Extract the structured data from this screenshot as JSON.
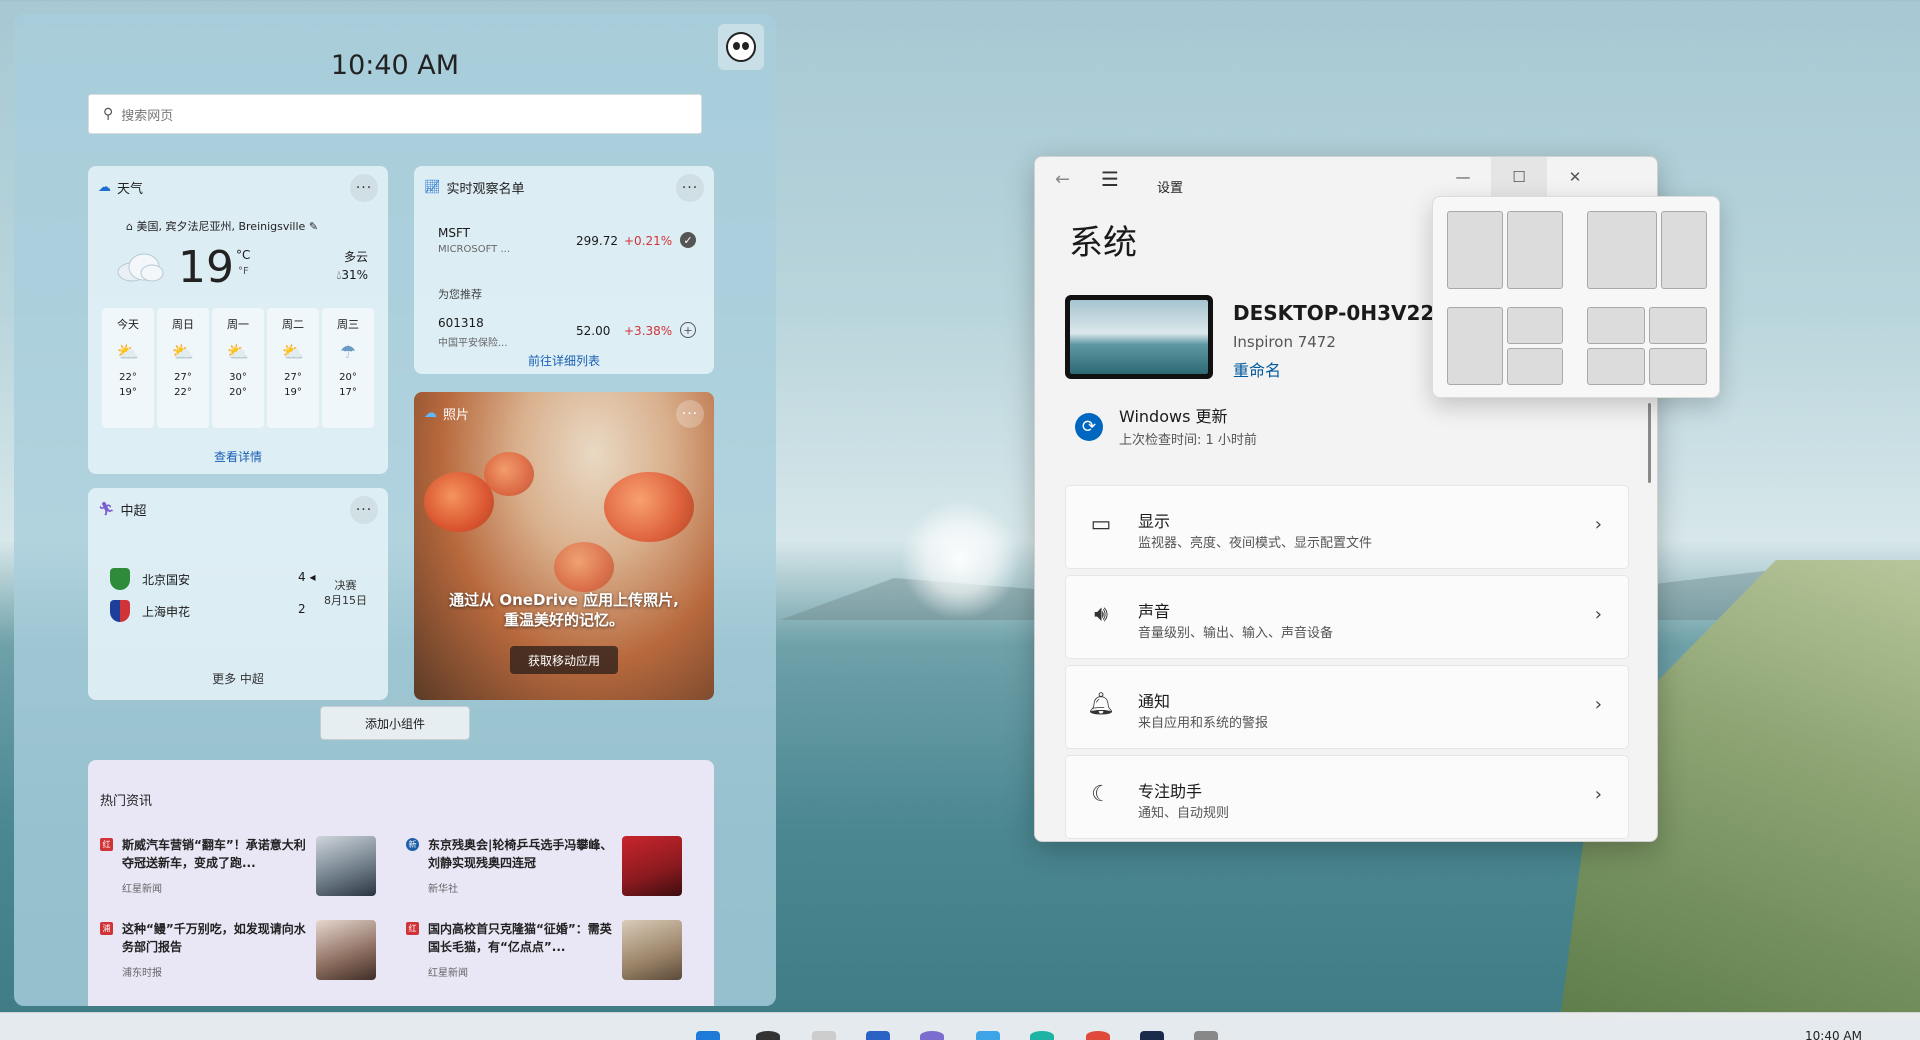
{
  "widgets": {
    "time": "10:40 AM",
    "search_placeholder": "搜索网页",
    "weather": {
      "title": "天气",
      "location": "美国, 宾夕法尼亚州, Breinigsville",
      "temp": "19",
      "unit_c": "°C",
      "unit_f": "°F",
      "condition": "多云",
      "precip": "31%",
      "forecast": [
        {
          "day": "今天",
          "hi": "22°",
          "lo": "19°",
          "icon": "partly-cloudy-rain-icon"
        },
        {
          "day": "周日",
          "hi": "27°",
          "lo": "22°",
          "icon": "partly-cloudy-rain-icon"
        },
        {
          "day": "周一",
          "hi": "30°",
          "lo": "20°",
          "icon": "partly-cloudy-rain-icon"
        },
        {
          "day": "周二",
          "hi": "27°",
          "lo": "19°",
          "icon": "partly-cloudy-icon"
        },
        {
          "day": "周三",
          "hi": "20°",
          "lo": "17°",
          "icon": "rain-icon"
        }
      ],
      "link": "查看详情"
    },
    "stocks": {
      "title": "实时观察名单",
      "items": [
        {
          "symbol": "MSFT",
          "name": "MICROSOFT ...",
          "price": "299.72",
          "change": "+0.21%",
          "action": "check-icon"
        },
        {
          "symbol": "601318",
          "name": "中国平安保险...",
          "price": "52.00",
          "change": "+3.38%",
          "action": "add-icon"
        }
      ],
      "recommended": "为您推荐",
      "link": "前往详细列表"
    },
    "photos": {
      "title": "照片",
      "message_line1": "通过从 OneDrive 应用上传照片,",
      "message_line2": "重温美好的记忆。",
      "button": "获取移动应用"
    },
    "soccer": {
      "title": "中超",
      "team1": "北京国安",
      "team1_score": "4",
      "team2": "上海申花",
      "team2_score": "2",
      "status": "决赛",
      "date": "8月15日",
      "link": "更多 中超"
    },
    "add_widget": "添加小组件",
    "news": {
      "title": "热门资讯",
      "items": [
        {
          "headline": "斯威汽车营销“翻车”！承诺意大利夺冠送新车，变成了跑...",
          "source": "红星新闻"
        },
        {
          "headline": "东京残奥会|轮椅乒乓选手冯攀峰、刘静实现残奥四连冠",
          "source": "新华社"
        },
        {
          "headline": "这种“鳗”千万别吃，如发现请向水务部门报告",
          "source": "浦东时报"
        },
        {
          "headline": "国内高校首只克隆猫“征婚”：需英国长毛猫，有“亿点点”...",
          "source": "红星新闻"
        }
      ]
    }
  },
  "settings": {
    "app_title": "设置",
    "page_heading": "系统",
    "device_name": "DESKTOP-0H3V22M",
    "device_model": "Inspiron 7472",
    "rename": "重命名",
    "update_title": "Windows 更新",
    "update_sub": "上次检查时间: 1 小时前",
    "rows": [
      {
        "title": "显示",
        "subtitle": "监视器、亮度、夜间模式、显示配置文件",
        "icon": "monitor-icon"
      },
      {
        "title": "声音",
        "subtitle": "音量级别、输出、输入、声音设备",
        "icon": "speaker-icon"
      },
      {
        "title": "通知",
        "subtitle": "来自应用和系统的警报",
        "icon": "bell-icon"
      },
      {
        "title": "专注助手",
        "subtitle": "通知、自动规则",
        "icon": "moon-icon"
      }
    ]
  },
  "taskbar": {
    "clock": "10:40 AM"
  },
  "colors": {
    "accent": "#0067c0",
    "stock_up": "#d13438",
    "link": "#1a5fb4"
  }
}
